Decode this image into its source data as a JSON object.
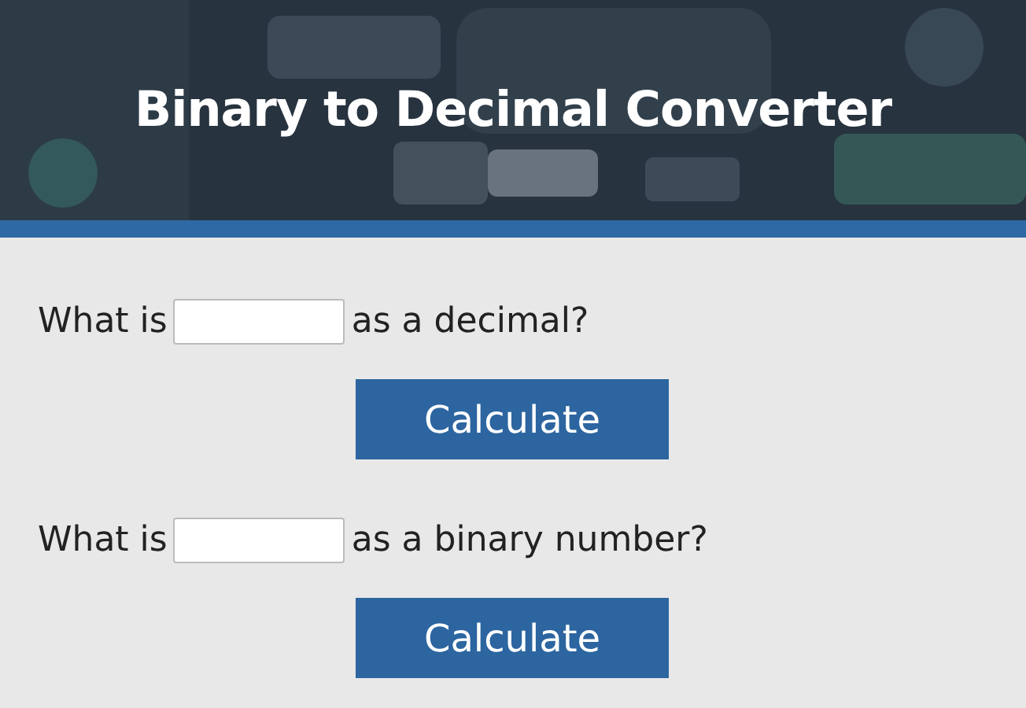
{
  "header": {
    "title": "Binary to Decimal Converter"
  },
  "questions": [
    {
      "prefix": "What is",
      "suffix": "as a decimal?",
      "button": "Calculate"
    },
    {
      "prefix": "What is",
      "suffix": "as a binary number?",
      "button": "Calculate"
    }
  ]
}
